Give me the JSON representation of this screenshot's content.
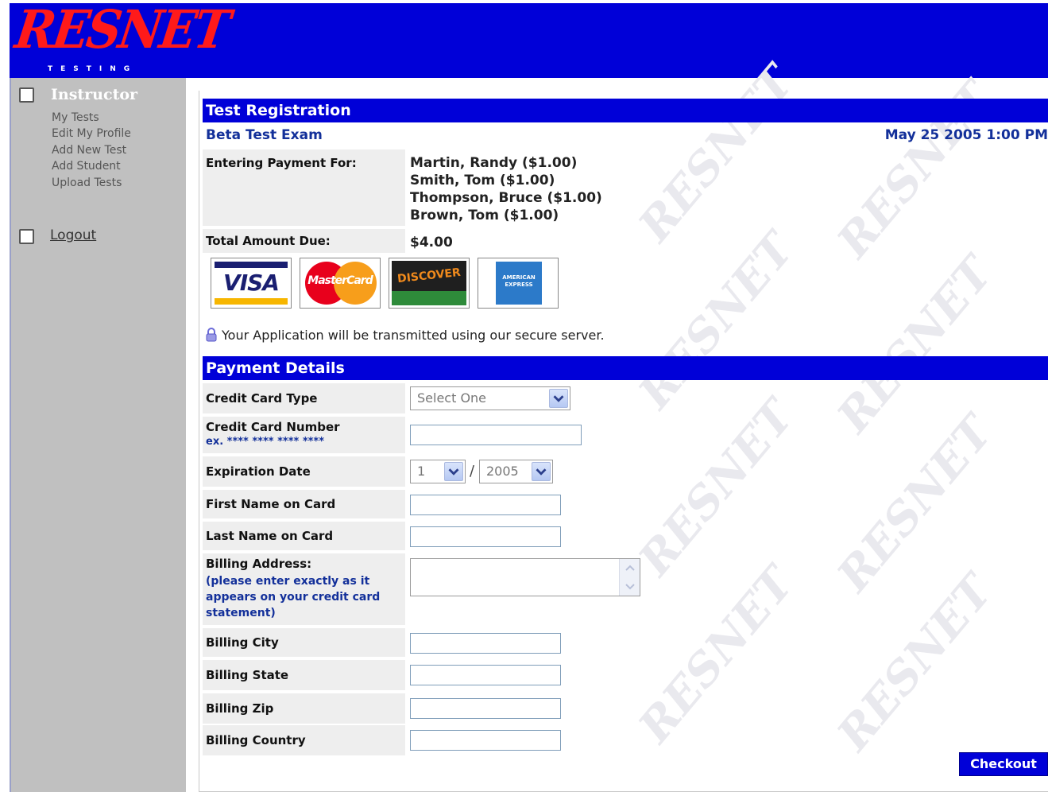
{
  "brand": {
    "logo": "RESNET",
    "logo_sub": "TESTING"
  },
  "sidebar": {
    "heading": "Instructor",
    "links": [
      "My Tests",
      "Edit My Profile",
      "Add New Test",
      "Add Student",
      "Upload Tests"
    ],
    "logout": "Logout"
  },
  "registration": {
    "section_title": "Test Registration",
    "exam_name": "Beta Test Exam",
    "exam_date": "May 25 2005 1:00 PM",
    "payment_for_label": "Entering Payment For:",
    "payees": [
      "Martin, Randy ($1.00)",
      "Smith, Tom ($1.00)",
      "Thompson, Bruce ($1.00)",
      "Brown, Tom ($1.00)"
    ],
    "total_label": "Total Amount Due:",
    "total_value": "$4.00",
    "cards": [
      "VISA",
      "MasterCard",
      "DISCOVER",
      "AMERICAN EXPRESS"
    ],
    "secure_text": "Your Application will be transmitted using our secure server."
  },
  "payment": {
    "section_title": "Payment Details",
    "card_type_label": "Credit Card Type",
    "card_type_value": "Select One",
    "card_number_label": "Credit Card Number",
    "card_number_hint": "ex. **** **** **** ****",
    "expiration_label": "Expiration Date",
    "exp_month": "1",
    "exp_sep": "/",
    "exp_year": "2005",
    "first_name_label": "First Name on Card",
    "last_name_label": "Last Name on Card",
    "address_label": "Billing Address:",
    "address_hint": "(please enter exactly as it appears on your credit card statement)",
    "city_label": "Billing City",
    "state_label": "Billing State",
    "zip_label": "Billing Zip",
    "country_label": "Billing Country",
    "checkout": "Checkout"
  },
  "colors": {
    "header": "#0000d8",
    "sidebar": "#c0c0c0",
    "label_cell": "#eeeeee",
    "logo": "#ff1a1a"
  }
}
